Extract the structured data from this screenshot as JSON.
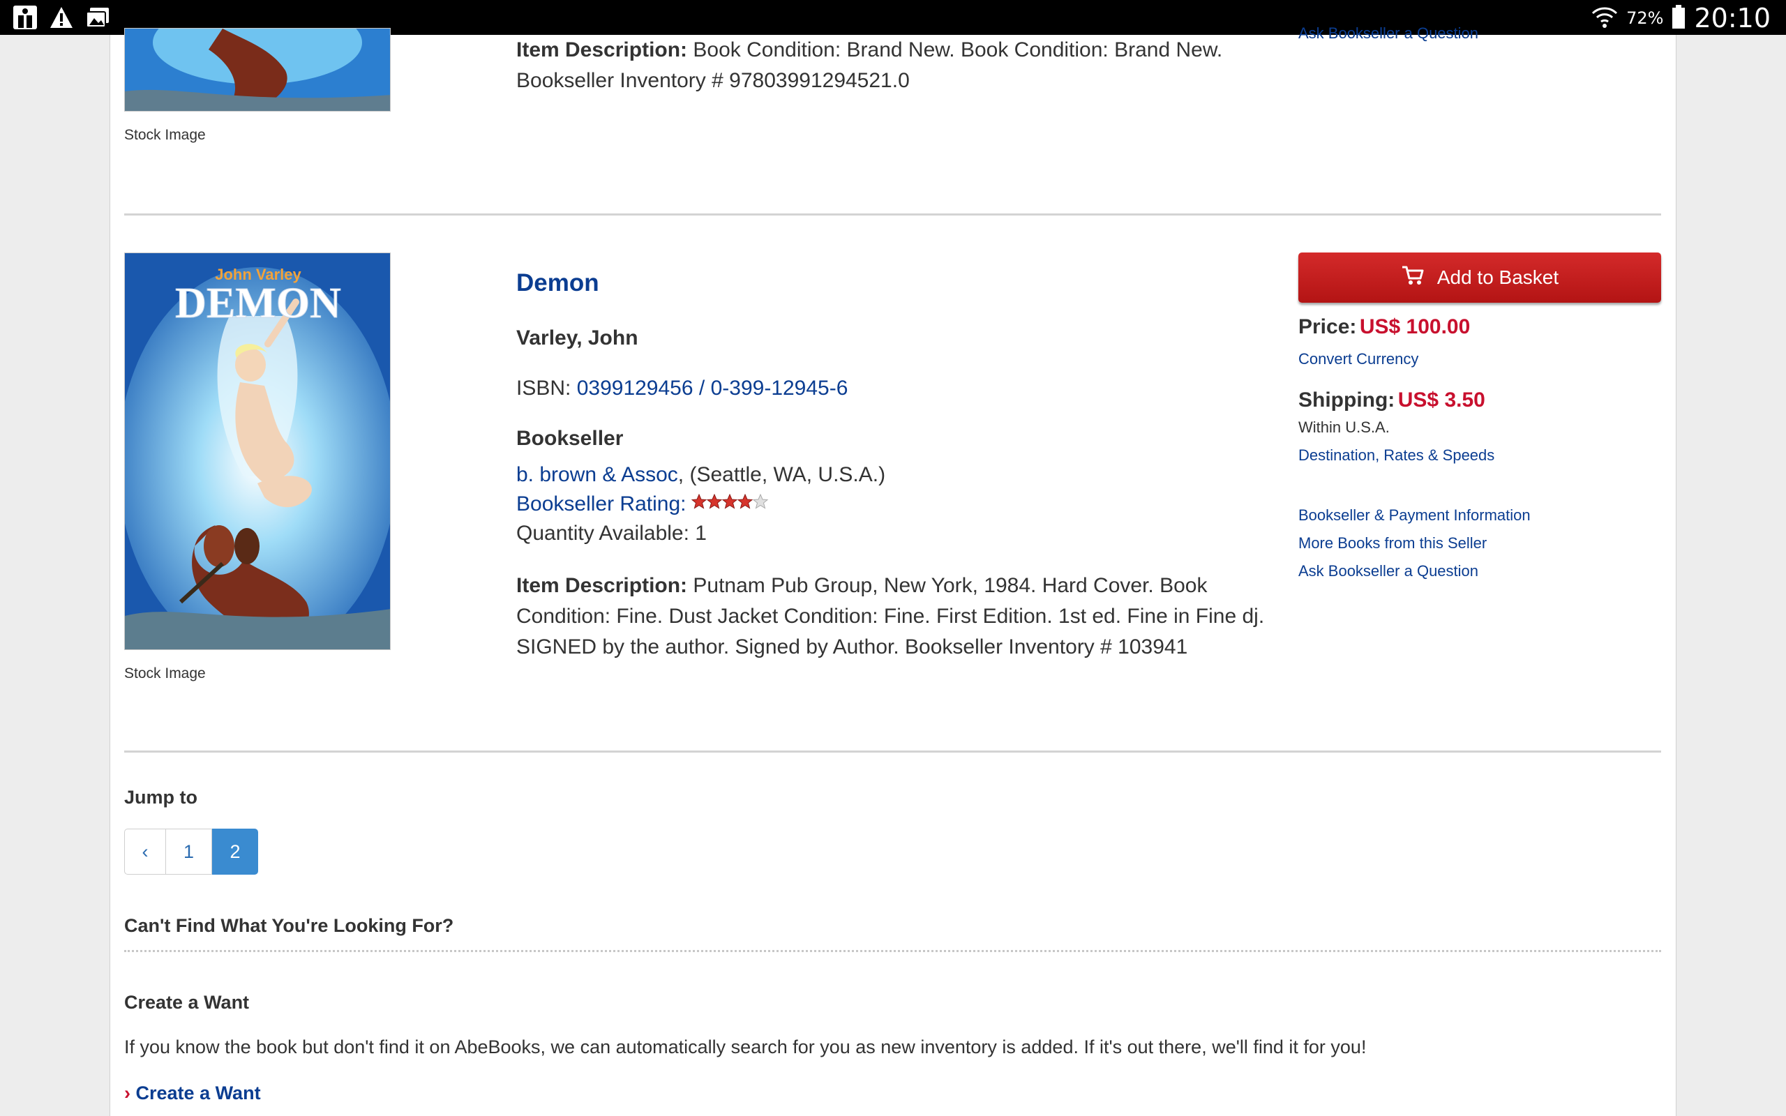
{
  "status_bar": {
    "battery_percent": "72%",
    "time": "20:10"
  },
  "previous_listing": {
    "description_label": "Item Description:",
    "description_line1": "Book Condition: Brand New. Book Condition: Brand New.",
    "description_line2": "Bookseller Inventory # 97803991294521.0",
    "cropped_link": "Ask Bookseller a Question",
    "image_caption": "Stock Image"
  },
  "listing": {
    "title": "Demon",
    "author": "Varley, John",
    "isbn_label": "ISBN:",
    "isbn10": "0399129456",
    "isbn_separator": "/",
    "isbn_formatted": "0-399-12945-6",
    "bookseller_heading": "Bookseller",
    "seller_name": "b. brown & Assoc",
    "seller_location": ", (Seattle, WA, U.S.A.)",
    "rating_label": "Bookseller Rating:",
    "rating_stars": 4,
    "rating_max": 5,
    "quantity": "Quantity Available: 1",
    "description_label": "Item Description:",
    "description_line1": "Putnam Pub Group, New York, 1984. Hard Cover. Book",
    "description_line2": "Condition: Fine. Dust Jacket Condition: Fine. First Edition. 1st ed. Fine in Fine dj.",
    "description_line3": "SIGNED by the author. Signed by Author. Bookseller Inventory # 103941",
    "image_caption": "Stock Image",
    "cover_author_text": "John Varley",
    "cover_title_text": "DEMON",
    "add_to_basket": "Add to Basket",
    "price_label": "Price:",
    "price_value": "US$ 100.00",
    "convert_currency": "Convert Currency",
    "shipping_label": "Shipping:",
    "shipping_value": "US$ 3.50",
    "shipping_region": "Within U.S.A.",
    "destination_link": "Destination, Rates & Speeds",
    "seller_links": [
      "Bookseller & Payment Information",
      "More Books from this Seller",
      "Ask Bookseller a Question"
    ]
  },
  "pagination": {
    "heading": "Jump to",
    "prev": "‹",
    "pages": [
      "1",
      "2"
    ],
    "current": "2"
  },
  "want": {
    "heading": "Can't Find What You're Looking For?",
    "subheading": "Create a Want",
    "body": "If you know the book but don't find it on AbeBooks, we can automatically search for you as new inventory is added. If it's out there, we'll find it for you!",
    "link_prefix": "›",
    "link": "Create a Want"
  },
  "colors": {
    "link_blue": "#0b3d91",
    "price_red": "#c8102e",
    "button_red": "#c41e1e",
    "pager_active": "#3a8bd0"
  }
}
